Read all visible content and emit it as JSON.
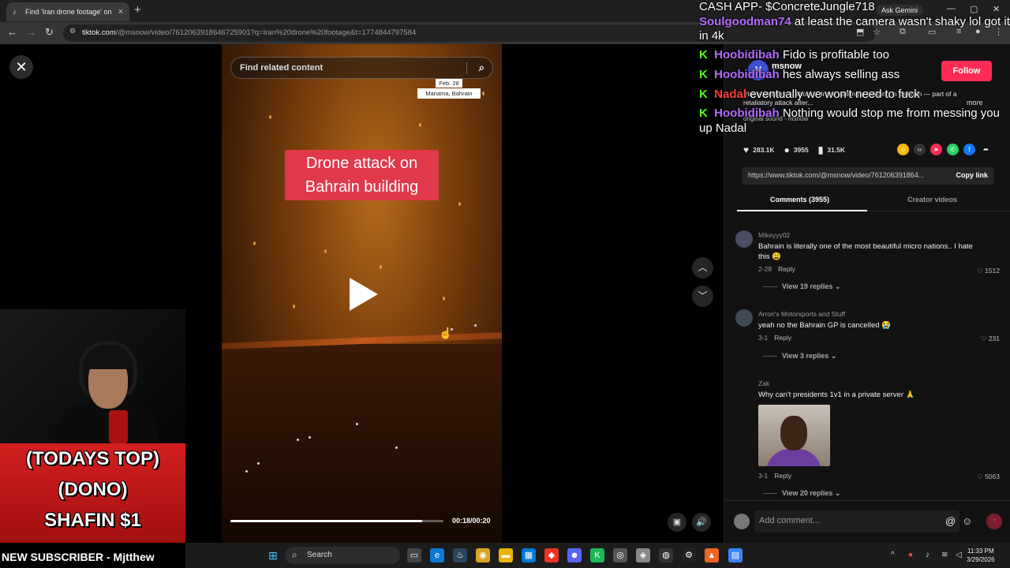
{
  "browser": {
    "tab_title": "Find 'Iran drone footage' on Ti",
    "url_host": "tiktok.com",
    "url_path": "/@msnow/video/7612063918646725901?q=Iran%20drone%20footage&t=1774844797584",
    "ask_label": "Ask Gemini"
  },
  "video": {
    "search_placeholder": "Find related content",
    "location_date": "Feb. 28",
    "location_place": "Manama, Bahrain",
    "caption_line1": "Drone attack on",
    "caption_line2": "Bahrain building",
    "time": "00:18/00:20",
    "progress_fraction": 0.9
  },
  "author": {
    "name": "msnow",
    "avatar_letter": "M",
    "follow_label": "Follow",
    "description": "Video appears to show a drone striking a building in Bahrain — part of a retaliatory attack after...",
    "more_label": "more",
    "sound": "original sound - msnow"
  },
  "stats": {
    "likes": "283.1K",
    "comments": "3955",
    "saves": "31.5K"
  },
  "link": {
    "url": "https://www.tiktok.com/@msnow/video/761206391864...",
    "copy_label": "Copy link"
  },
  "tabs": {
    "comments": "Comments (3955)",
    "creator": "Creator videos"
  },
  "comments": [
    {
      "user": "Mikeyyy02",
      "text": "Bahrain is literally one of the most beautiful micro nations.. I hate this 😩",
      "date": "2-28",
      "reply": "Reply",
      "likes": "1512",
      "replies": "View 19 replies"
    },
    {
      "user": "Arron's Motorsports and Stuff",
      "text": "yeah no the Bahrain GP is cancelled 😭",
      "date": "3-1",
      "reply": "Reply",
      "likes": "231",
      "replies": "View 3 replies"
    },
    {
      "user": "Zak",
      "text": "Why can't presidents 1v1 in a private server 🙏",
      "date": "3-1",
      "reply": "Reply",
      "likes": "5063",
      "replies": "View 20 replies"
    }
  ],
  "add_comment": {
    "placeholder": "Add comment..."
  },
  "chat": {
    "header": "CASH APP- $ConcreteJungle718",
    "messages": [
      {
        "user": "Soulgoodman74",
        "color": "purple",
        "text": "at least the camera wasn't shaky lol got it in 4k"
      },
      {
        "user": "Hoobidibah",
        "color": "purple",
        "text": "Fido is profitable too"
      },
      {
        "user": "Hoobidibah",
        "color": "purple",
        "text": "hes always selling ass"
      },
      {
        "user": "Nadal",
        "color": "red",
        "text": "eventually we won't need to fuck"
      },
      {
        "user": "Hoobidibah",
        "color": "purple",
        "text": "Nothing would stop me from messing you up Nadal"
      }
    ]
  },
  "stream": {
    "dono_line1": "(TODAYS TOP)",
    "dono_line2": "(DONO)",
    "dono_line3": "SHAFIN $1",
    "subscriber": "NEW SUBSCRIBER - Mjtthew"
  },
  "taskbar": {
    "search_label": "Search",
    "time": "11:33 PM",
    "date": "3/29/2026"
  },
  "colors": {
    "follow": "#fe2c55",
    "caption_bg": "#e0394c",
    "kick_green": "#53fc18",
    "dono_red": "#d42020"
  }
}
